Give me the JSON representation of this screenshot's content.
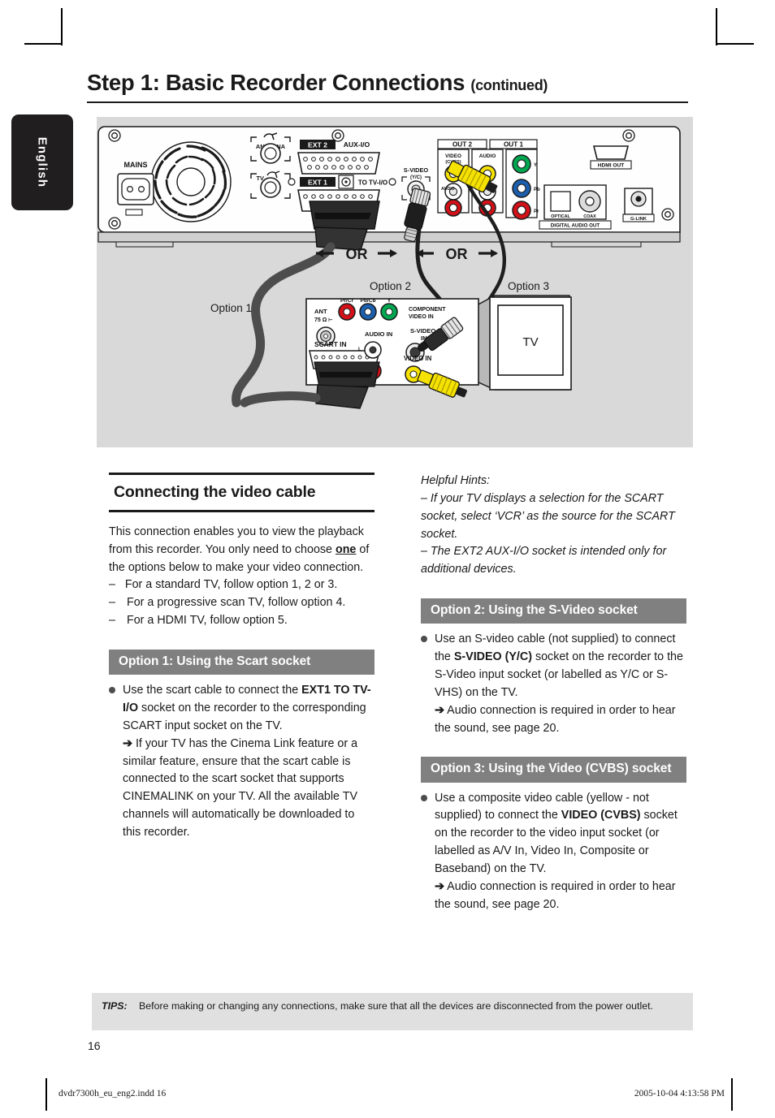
{
  "page": {
    "language_tab": "English",
    "page_number": "16",
    "title_main": "Step 1: Basic Recorder Connections",
    "title_suffix": "(continued)"
  },
  "diagram": {
    "or_label_left": "OR",
    "or_label_right": "OR",
    "option1_label": "Option 1",
    "option2_label": "Option 2",
    "option3_label": "Option 3",
    "tv_label": "TV",
    "recorder_labels": {
      "mains": "MAINS",
      "antenna": "ANTENNA",
      "tv": "TV",
      "ext2": "EXT 2",
      "aux_io": "AUX-I/O",
      "ext1": "EXT 1",
      "to_tv_io": "TO TV-I/O",
      "svideo": "S-VIDEO",
      "svideo_yc": "(Y/C)",
      "out2": "OUT 2",
      "out1": "OUT 1",
      "video_cvbs": "VIDEO (CVBS)",
      "audio": "AUDIO",
      "audio_l": "L",
      "audio_r": "R",
      "comp_y": "Y",
      "comp_pb": "Pb",
      "comp_pr": "Pr",
      "hdmi_out": "HDMI OUT",
      "digital_audio_out": "DIGITAL AUDIO OUT",
      "optical": "OPTICAL",
      "coax": "COAX",
      "glink": "G-LINK"
    },
    "tv_panel_labels": {
      "ant": "ANT",
      "ant_ohm": "75 Ω",
      "pr_cr": "Pr/Cr",
      "pb_cb": "Pb/Cb",
      "y": "Y",
      "component_video_in": "COMPONENT VIDEO IN",
      "svideo_in": "S-VIDEO IN",
      "scart_in": "SCART IN",
      "audio_in": "AUDIO IN",
      "audio_l": "L",
      "audio_r": "R",
      "video_in": "VIDEO IN"
    }
  },
  "left_column": {
    "section_title": "Connecting the video cable",
    "intro_1": "This connection enables you to view the playback from this recorder. You only need to choose ",
    "intro_strong": "one",
    "intro_2": " of the options below to make your video connection.",
    "dash1": "For a standard TV, follow option 1, 2 or 3.",
    "dash2": "For a progressive scan TV, follow option 4.",
    "dash3": "For a HDMI TV, follow option 5.",
    "option1_bar": "Option 1: Using the Scart socket",
    "option1_p1a": "Use the scart cable to connect the ",
    "option1_p1_strong": "EXT1 TO TV-I/O",
    "option1_p1b": " socket on the recorder to the corresponding SCART input socket on the TV.",
    "option1_arrow": "➔",
    "option1_p2": " If your TV has the Cinema Link feature or a similar feature, ensure that the scart cable is connected to the scart socket that supports CINEMALINK on your TV. All the available TV channels will automatically be downloaded to this recorder."
  },
  "right_column": {
    "hints_title": "Helpful Hints:",
    "hint1": "–  If your TV displays a selection for the SCART socket, select ‘VCR’ as the source for the SCART socket.",
    "hint2": "–  The EXT2 AUX-I/O socket is intended only for additional devices.",
    "option2_bar": "Option 2: Using the S-Video socket",
    "option2_p1a": "Use an S-video cable (not supplied) to connect the ",
    "option2_p1_strong": "S-VIDEO (Y/C)",
    "option2_p1b": " socket on the recorder to the S-Video input socket (or labelled as Y/C or S-VHS) on the TV.",
    "option2_arrow": "➔",
    "option2_p2": " Audio connection is required in order to hear the sound, see page 20.",
    "option3_bar": "Option 3: Using the Video (CVBS) socket",
    "option3_p1a": "Use a composite video cable (yellow - not supplied) to connect the ",
    "option3_p1_strong": "VIDEO (CVBS)",
    "option3_p1b": " socket on the recorder to the video input socket (or labelled as A/V In, Video In, Composite or Baseband) on the TV.",
    "option3_arrow": "➔",
    "option3_p2": " Audio connection is required in order to hear the sound, see page 20."
  },
  "tips": {
    "label": "TIPS:",
    "text": "Before making or changing any connections, make sure that all the devices are disconnected from the power outlet."
  },
  "printer_footer": {
    "file": "dvdr7300h_eu_eng2.indd   16",
    "timestamp": "2005-10-04   4:13:58 PM"
  },
  "colors": {
    "option_bar_bg": "#808080",
    "diagram_bg": "#d9d9d9",
    "tips_bg": "#e0e0e0",
    "tab_bg": "#201e1e"
  }
}
